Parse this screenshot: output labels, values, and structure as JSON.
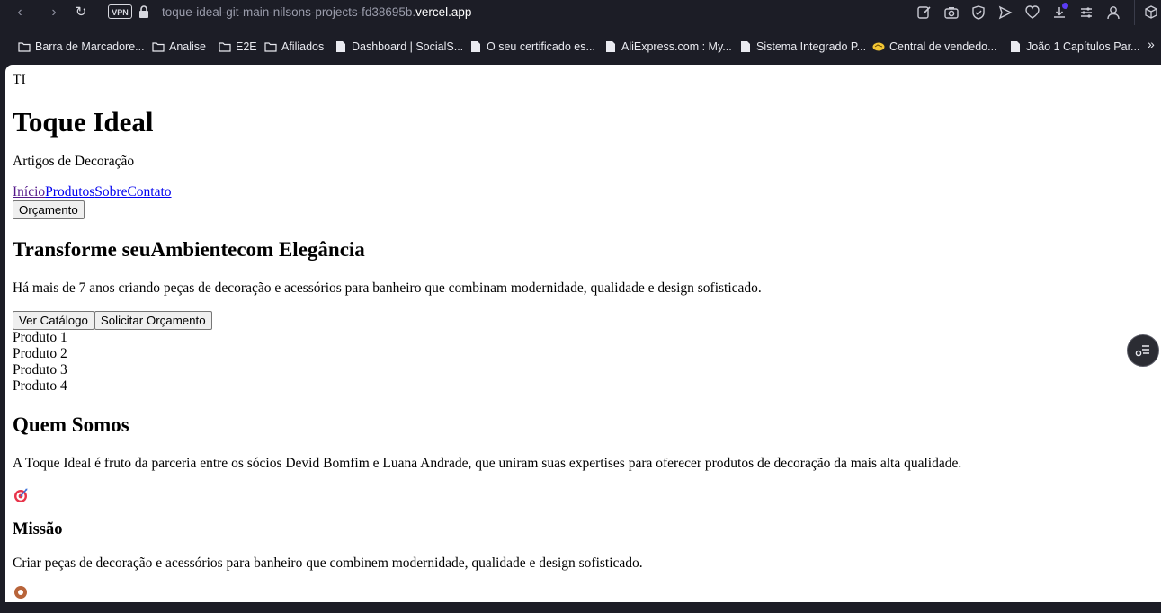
{
  "browser": {
    "vpn_label": "VPN",
    "url_path": "toque-ideal-git-main-nilsons-projects-fd38695b.",
    "url_domain": "vercel.app",
    "bookmarks": [
      {
        "icon": "folder-icon",
        "label": "Barra de Marcadore..."
      },
      {
        "icon": "folder-icon",
        "label": "Analise"
      },
      {
        "icon": "folder-icon",
        "label": "E2E"
      },
      {
        "icon": "folder-icon",
        "label": "Afiliados"
      },
      {
        "icon": "page-icon",
        "label": "Dashboard | SocialS..."
      },
      {
        "icon": "page-icon",
        "label": "O seu certificado es..."
      },
      {
        "icon": "page-icon",
        "label": "AliExpress.com : My..."
      },
      {
        "icon": "page-icon",
        "label": "Sistema Integrado P..."
      },
      {
        "icon": "handshake-icon",
        "label": "Central de vendedo..."
      },
      {
        "icon": "page-icon",
        "label": "João 1 Capítulos Par..."
      }
    ],
    "more_label": "»"
  },
  "page": {
    "logo_text": "TI",
    "brand_title": "Toque Ideal",
    "brand_subtitle": "Artigos de Decoração",
    "nav": [
      "Início",
      "Produtos",
      "Sobre",
      "Contato"
    ],
    "quote_button": "Orçamento",
    "hero_title": "Transforme seuAmbientecom Elegância",
    "hero_text": "Há mais de 7 anos criando peças de decoração e acessórios para banheiro que combinam modernidade, qualidade e design sofisticado.",
    "hero_buttons": [
      "Ver Catálogo",
      "Solicitar Orçamento"
    ],
    "products": [
      "Produto 1",
      "Produto 2",
      "Produto 3",
      "Produto 4"
    ],
    "about_title": "Quem Somos",
    "about_text": "A Toque Ideal é fruto da parceria entre os sócios Devid Bomfim e Luana Andrade, que uniram suas expertises para oferecer produtos de decoração da mais alta qualidade.",
    "mission_icon": "target-icon",
    "mission_title": "Missão",
    "mission_text": "Criar peças de decoração e acessórios para banheiro que combinem modernidade, qualidade e design sofisticado."
  }
}
